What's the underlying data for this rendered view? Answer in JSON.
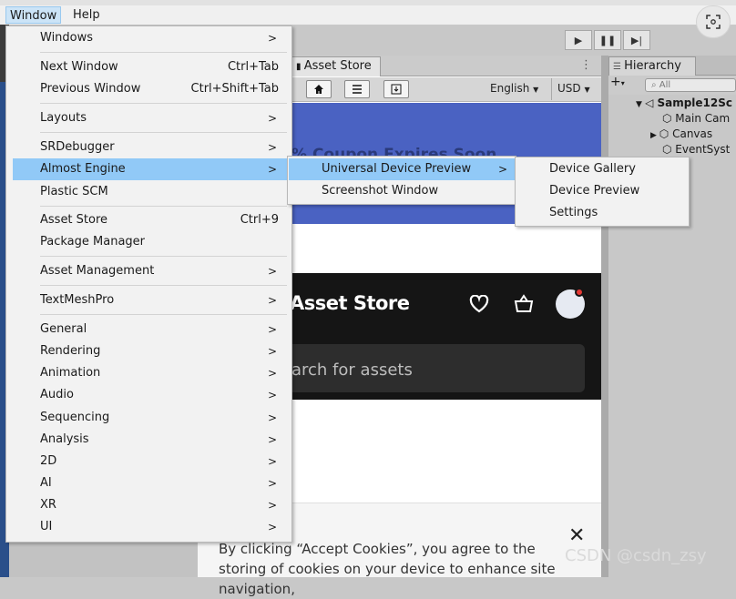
{
  "menubar": {
    "window_label": "Window",
    "help_label": "Help"
  },
  "window_menu": {
    "items": [
      {
        "label": "Windows",
        "shortcut": "",
        "submenu": true
      },
      {
        "label": "Next Window",
        "shortcut": "Ctrl+Tab",
        "submenu": false
      },
      {
        "label": "Previous Window",
        "shortcut": "Ctrl+Shift+Tab",
        "submenu": false
      },
      {
        "label": "Layouts",
        "shortcut": "",
        "submenu": true
      },
      {
        "label": "SRDebugger",
        "shortcut": "",
        "submenu": true
      },
      {
        "label": "Almost Engine",
        "shortcut": "",
        "submenu": true,
        "highlighted": true
      },
      {
        "label": "Plastic SCM",
        "shortcut": "",
        "submenu": false
      },
      {
        "label": "Asset Store",
        "shortcut": "Ctrl+9",
        "submenu": false
      },
      {
        "label": "Package Manager",
        "shortcut": "",
        "submenu": false
      },
      {
        "label": "Asset Management",
        "shortcut": "",
        "submenu": true
      },
      {
        "label": "TextMeshPro",
        "shortcut": "",
        "submenu": true
      },
      {
        "label": "General",
        "shortcut": "",
        "submenu": true
      },
      {
        "label": "Rendering",
        "shortcut": "",
        "submenu": true
      },
      {
        "label": "Animation",
        "shortcut": "",
        "submenu": true
      },
      {
        "label": "Audio",
        "shortcut": "",
        "submenu": true
      },
      {
        "label": "Sequencing",
        "shortcut": "",
        "submenu": true
      },
      {
        "label": "Analysis",
        "shortcut": "",
        "submenu": true
      },
      {
        "label": "2D",
        "shortcut": "",
        "submenu": true
      },
      {
        "label": "AI",
        "shortcut": "",
        "submenu": true
      },
      {
        "label": "XR",
        "shortcut": "",
        "submenu": true
      },
      {
        "label": "UI",
        "shortcut": "",
        "submenu": true
      }
    ]
  },
  "almost_engine_menu": {
    "items": [
      {
        "label": "Universal Device Preview",
        "submenu": true,
        "highlighted": true
      },
      {
        "label": "Screenshot Window",
        "submenu": false
      }
    ]
  },
  "udp_menu": {
    "items": [
      {
        "label": "Device Gallery"
      },
      {
        "label": "Device Preview"
      },
      {
        "label": "Settings"
      }
    ]
  },
  "asset_store": {
    "tab_label": "Asset Store",
    "language": "English",
    "currency": "USD",
    "promo_text": "% Coupon Expires Soon",
    "store_title": "Asset Store",
    "search_placeholder": "arch for assets",
    "cookie_text": "By clicking “Accept Cookies”, you agree to the storing of cookies on your device to enhance site navigation,"
  },
  "hierarchy": {
    "tab_label": "Hierarchy",
    "search_placeholder": "All",
    "scene": "Sample12Sc",
    "items": [
      "Main Cam",
      "Canvas",
      "EventSyst"
    ]
  },
  "watermark": "CSDN @csdn_zsy"
}
